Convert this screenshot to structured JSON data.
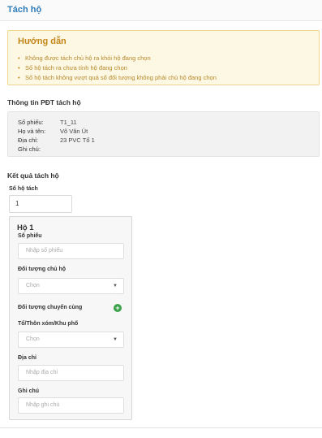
{
  "header": {
    "title": "Tách hộ"
  },
  "guide": {
    "title": "Hướng dẫn",
    "items": [
      "Không được tách chủ hộ ra khỏi hộ đang chọn",
      "Số hộ tách ra chưa tính hộ đang chọn",
      "Số hộ tách không vượt quá số đối tượng không phải chủ hộ đang chọn"
    ]
  },
  "info": {
    "section_title": "Thông tin PĐT tách hộ",
    "rows": [
      {
        "label": "Số phiếu:",
        "value": "T1_11"
      },
      {
        "label": "Họ và tên:",
        "value": "Võ Văn Út"
      },
      {
        "label": "Địa chỉ:",
        "value": "23 PVC Tổ 1"
      },
      {
        "label": "Ghi chú:",
        "value": ""
      }
    ]
  },
  "result": {
    "section_title": "Kết quả tách hộ",
    "count_label": "Số hộ tách",
    "count_value": "1"
  },
  "household": {
    "title": "Hộ 1",
    "receipt_label": "Số phiếu",
    "receipt_placeholder": "Nhập số phiếu",
    "head_label": "Đối tượng chủ hộ",
    "head_value": "Chọn",
    "moving_label": "Đối tượng chuyển cùng",
    "area_label": "Tổ/Thôn xóm/Khu phố",
    "area_value": "Chọn",
    "address_label": "Địa chỉ",
    "address_placeholder": "Nhập địa chỉ",
    "note_label": "Ghi chú",
    "note_placeholder": "Nhập ghi chú"
  },
  "icons": {
    "add": "plus-circle-icon",
    "dropdown": "caret-down-icon",
    "bullet": "bullet-dot"
  },
  "colors": {
    "title_blue": "#2e7cb8",
    "guide_bg": "#fdf8e4",
    "guide_text": "#c4861a",
    "add_green": "#3aa14a"
  }
}
